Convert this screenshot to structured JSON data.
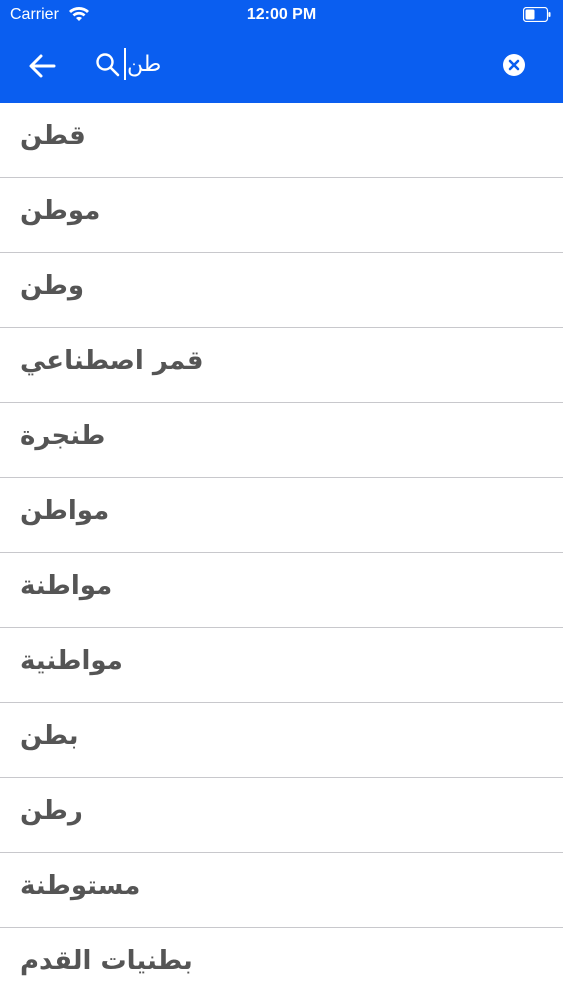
{
  "status_bar": {
    "carrier": "Carrier",
    "time": "12:00 PM"
  },
  "toolbar": {
    "search_value": "طن"
  },
  "results": [
    "قطن",
    "موطن",
    "وطن",
    "قمر اصطناعي",
    "طنجرة",
    "مواطن",
    "مواطنة",
    "مواطنية",
    "بطن",
    "رطن",
    "مستوطنة",
    "بطنيات القدم"
  ],
  "colors": {
    "header_bg": "#0a5ef0",
    "text_primary": "#555555",
    "divider": "#c8c8cc"
  }
}
